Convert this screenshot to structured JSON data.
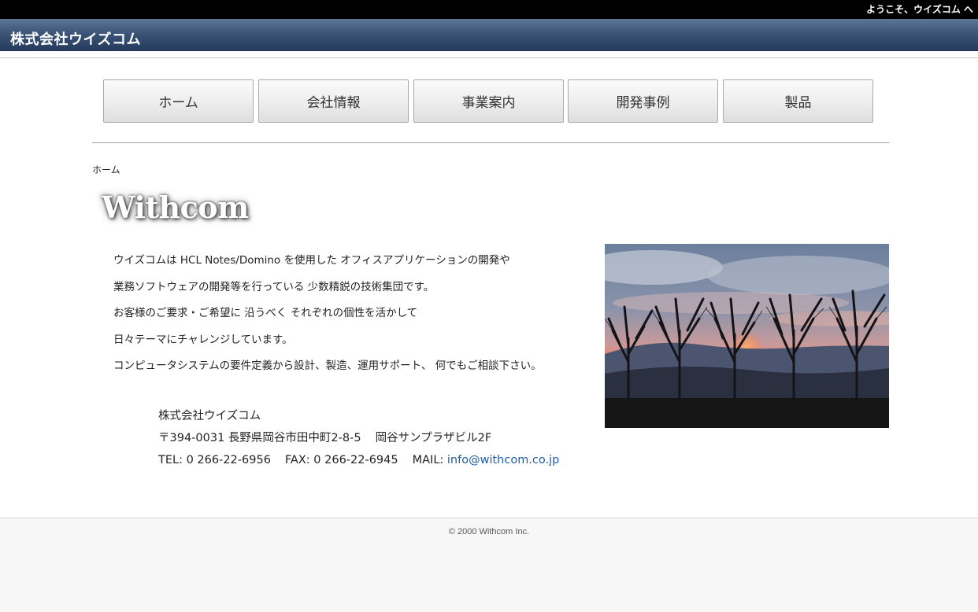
{
  "topbar": {
    "welcome": "ようこそ、ウイズコム へ"
  },
  "header": {
    "site_title": "株式会社ウイズコム"
  },
  "nav": {
    "items": [
      {
        "label": "ホーム"
      },
      {
        "label": "会社情報"
      },
      {
        "label": "事業案内"
      },
      {
        "label": "開発事例"
      },
      {
        "label": "製品"
      }
    ]
  },
  "breadcrumb": {
    "current": "ホーム"
  },
  "logo": {
    "text": "Withcom"
  },
  "intro": {
    "lines": [
      "ウイズコムは HCL Notes/Domino を使用した オフィスアプリケーションの開発や",
      "業務ソフトウェアの開発等を行っている 少数精鋭の技術集団です。",
      "お客様のご要求・ご希望に 沿うべく それぞれの個性を活かして",
      "日々テーマにチャレンジしています。",
      "コンピュータシステムの要件定義から設計、製造、運用サポート、 何でもご相談下さい。"
    ]
  },
  "address": {
    "company": "株式会社ウイズコム",
    "postal": "〒394-0031 長野県岡谷市田中町2-8-5",
    "building": "岡谷サンプラザビル2F",
    "tel": "TEL:  0 266-22-6956",
    "fax": "FAX:  0 266-22-6945",
    "mail_label": "MAIL:",
    "mail": "info@withcom.co.jp"
  },
  "footer": {
    "copyright": "© 2000 Withcom Inc."
  },
  "colors": {
    "header_top": "#5d7696",
    "header_bottom": "#243a5c",
    "link": "#1a5fa8"
  },
  "image": {
    "description_icon": "sunset-trees-photo"
  }
}
